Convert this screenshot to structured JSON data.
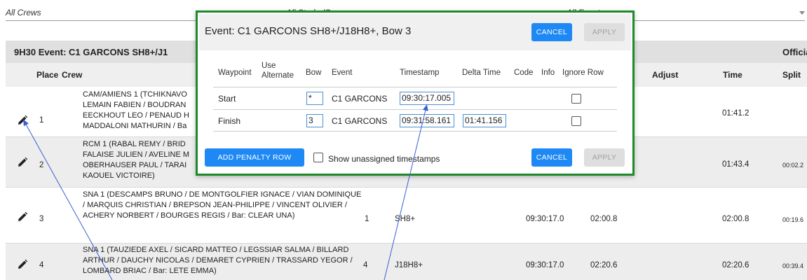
{
  "filters": {
    "crews": "All Crews",
    "stroke_cox": "All Stroke/Cox",
    "events": "All Events"
  },
  "event_header": {
    "title": "9H30 Event: C1 GARCONS SH8+/J1",
    "official": "Officia"
  },
  "columns": {
    "place": "Place",
    "crew": "Crew",
    "adjust": "Adjust",
    "time": "Time",
    "split": "Split"
  },
  "rows": [
    {
      "place": "1",
      "crew": "CAM/AMIENS 1 (TCHIKNAVO LEMAIN FABIEN / BOUDRAN EECKHOUT LEO / PENAUD H MADDALONI MATHURIN / Ba",
      "time": "01:41.2",
      "split": ""
    },
    {
      "place": "2",
      "crew": "RCM 1 (RABAL REMY / BRID FALAISE JULIEN / AVELINE M OBERHAUSER PAUL / TARAI KAOUEL VICTOIRE)",
      "time": "01:43.4",
      "split": "00:02.2"
    },
    {
      "place": "3",
      "crew": "SNA 1 (DESCAMPS BRUNO / DE MONTGOLFIER IGNACE / VIAN DOMINIQUE / MARQUIS CHRISTIAN / BREPSON JEAN-PHILIPPE / VINCENT OLIVIER / ACHERY NORBERT / BOURGES REGIS / Bar: CLEAR UNA)",
      "bow": "1",
      "event": "SH8+",
      "start": "09:30:17.0",
      "raw": "02:00.8",
      "time": "02:00.8",
      "split": "00:19.6"
    },
    {
      "place": "4",
      "crew": "SNA 1 (TAUZIEDE AXEL / SICARD MATTEO / LEGSSIAR SALMA / BILLARD ARTHUR / DAUCHY NICOLAS / DEMARET CYPRIEN / TRASSARD YEGOR / LOMBARD BRIAC / Bar: LETE EMMA)",
      "bow": "4",
      "event": "J18H8+",
      "start": "09:30:17.0",
      "raw": "02:20.6",
      "time": "02:20.6",
      "split": "00:39.4"
    }
  ],
  "modal": {
    "title": "Event: C1 GARCONS SH8+/J18H8+, Bow 3",
    "cancel": "CANCEL",
    "apply": "APPLY",
    "headers": {
      "waypoint": "Waypoint",
      "use_alternate_1": "Use",
      "use_alternate_2": "Alternate",
      "bow": "Bow",
      "event": "Event",
      "timestamp": "Timestamp",
      "delta": "Delta Time",
      "code": "Code",
      "info": "Info",
      "ignore": "Ignore Row"
    },
    "rows": [
      {
        "waypoint": "Start",
        "bow": "*",
        "event": "C1 GARCONS",
        "timestamp": "09:30:17.005",
        "delta": ""
      },
      {
        "waypoint": "Finish",
        "bow": "3",
        "event": "C1 GARCONS",
        "timestamp": "09:31:58.161",
        "delta": "01:41.156"
      }
    ],
    "add_penalty": "ADD PENALTY ROW",
    "show_unassigned": "Show unassigned timestamps"
  },
  "colors": {
    "accent": "#1e88f5",
    "modal_border": "#1e8a2b",
    "annotation_arrow": "#3a5fd0"
  }
}
